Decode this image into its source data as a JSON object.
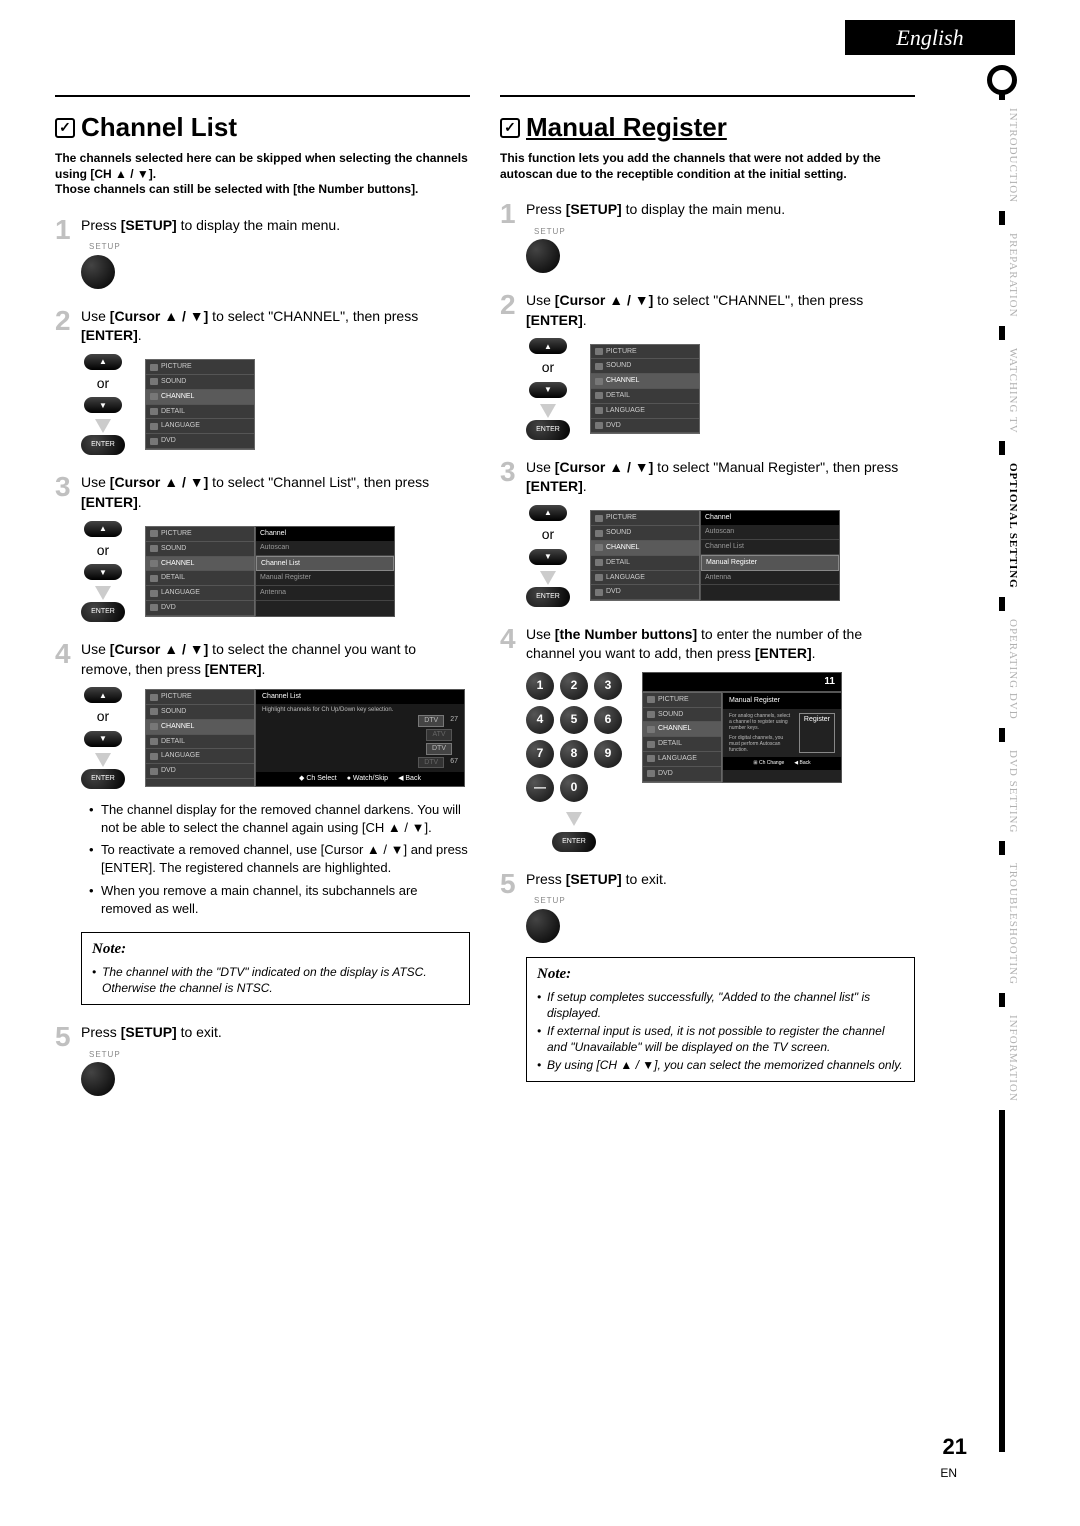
{
  "language": "English",
  "side_tabs": [
    "INTRODUCTION",
    "PREPARATION",
    "WATCHING  TV",
    "OPTIONAL  SETTING",
    "OPERATING  DVD",
    "DVD  SETTING",
    "TROUBLESHOOTING",
    "INFORMATION"
  ],
  "active_tab": "OPTIONAL  SETTING",
  "page_number": "21",
  "lang_code": "EN",
  "left": {
    "title": "Channel List",
    "intro1": "The channels selected here can be skipped when selecting the channels using [CH ▲ / ▼].",
    "intro2": "Those channels can still be selected with [the Number buttons].",
    "step1": {
      "t1": "Press ",
      "b1": "[SETUP]",
      "t2": " to display the main menu."
    },
    "setup_label": "SETUP",
    "step2": {
      "t1": "Use ",
      "b1": "[Cursor ▲ / ▼]",
      "t2": " to select \"CHANNEL\", then press ",
      "b2": "[ENTER]",
      "t3": "."
    },
    "or": "or",
    "enter_label": "ENTER",
    "menu": [
      "PICTURE",
      "SOUND",
      "CHANNEL",
      "DETAIL",
      "LANGUAGE",
      "DVD"
    ],
    "step3": {
      "t1": "Use ",
      "b1": "[Cursor ▲ / ▼]",
      "t2": " to select \"Channel List\", then press ",
      "b2": "[ENTER]",
      "t3": "."
    },
    "submenu_header": "Channel",
    "submenu_items": [
      "Autoscan",
      "Channel List",
      "Manual Register",
      "Antenna"
    ],
    "submenu_selected": "Channel List",
    "step4": {
      "t1": "Use ",
      "b1": "[Cursor ▲ / ▼]",
      "t2": " to select the channel you want to remove, then press ",
      "b2": "[ENTER]",
      "t3": "."
    },
    "chlist_title": "Channel List",
    "chlist_hint": "Highlight channels for Ch Up/Down key selection.",
    "chlist_rows": [
      [
        "DTV",
        "27"
      ],
      [
        "ATV",
        ""
      ],
      [
        "DTV",
        ""
      ],
      [
        "DTV",
        "67"
      ]
    ],
    "chlist_foot": [
      "Ch Select",
      "Watch/Skip",
      "Back"
    ],
    "bullets": [
      "The channel display for the removed channel darkens. You will not be able to select the channel again using [CH ▲ / ▼].",
      "To reactivate a removed channel, use [Cursor ▲ / ▼] and press [ENTER]. The registered channels are highlighted.",
      "When you remove a main channel, its subchannels are removed as well."
    ],
    "note_title": "Note:",
    "note_items": [
      "The channel with the \"DTV\" indicated on the display is ATSC. Otherwise the channel is NTSC."
    ],
    "step5": {
      "t1": "Press ",
      "b1": "[SETUP]",
      "t2": " to exit."
    }
  },
  "right": {
    "title": "Manual Register",
    "intro": "This function lets you add the channels that were not added by the autoscan due to the receptible condition at the initial setting.",
    "step1": {
      "t1": "Press ",
      "b1": "[SETUP]",
      "t2": " to display the main menu."
    },
    "step2": {
      "t1": "Use ",
      "b1": "[Cursor ▲ / ▼]",
      "t2": " to select \"CHANNEL\", then press ",
      "b2": "[ENTER]",
      "t3": "."
    },
    "step3": {
      "t1": "Use ",
      "b1": "[Cursor ▲ / ▼]",
      "t2": " to select \"Manual Register\", then press ",
      "b2": "[ENTER]",
      "t3": "."
    },
    "submenu_selected": "Manual Register",
    "step4": {
      "t1": "Use ",
      "b1": "[the Number buttons]",
      "t2": " to enter the number of the channel you want to add, then press ",
      "b2": "[ENTER]",
      "t3": "."
    },
    "keypad": [
      "1",
      "2",
      "3",
      "4",
      "5",
      "6",
      "7",
      "8",
      "9",
      "—",
      "0",
      ""
    ],
    "reg_top_num": "11",
    "reg_title": "Manual Register",
    "reg_text1": "For analog channels, select a channel to register using number keys.",
    "reg_text2": "For digital channels, you must perform Autoscan function.",
    "reg_button": "Register",
    "reg_foot": [
      "Ch Change",
      "Back"
    ],
    "step5": {
      "t1": "Press ",
      "b1": "[SETUP]",
      "t2": " to exit."
    },
    "note_title": "Note:",
    "note_items": [
      "If setup completes successfully, \"Added to the channel list\" is displayed.",
      "If external input is used, it is not possible to register the channel and \"Unavailable\" will be displayed on the TV screen.",
      "By using [CH ▲ / ▼], you can select the memorized channels only."
    ]
  }
}
